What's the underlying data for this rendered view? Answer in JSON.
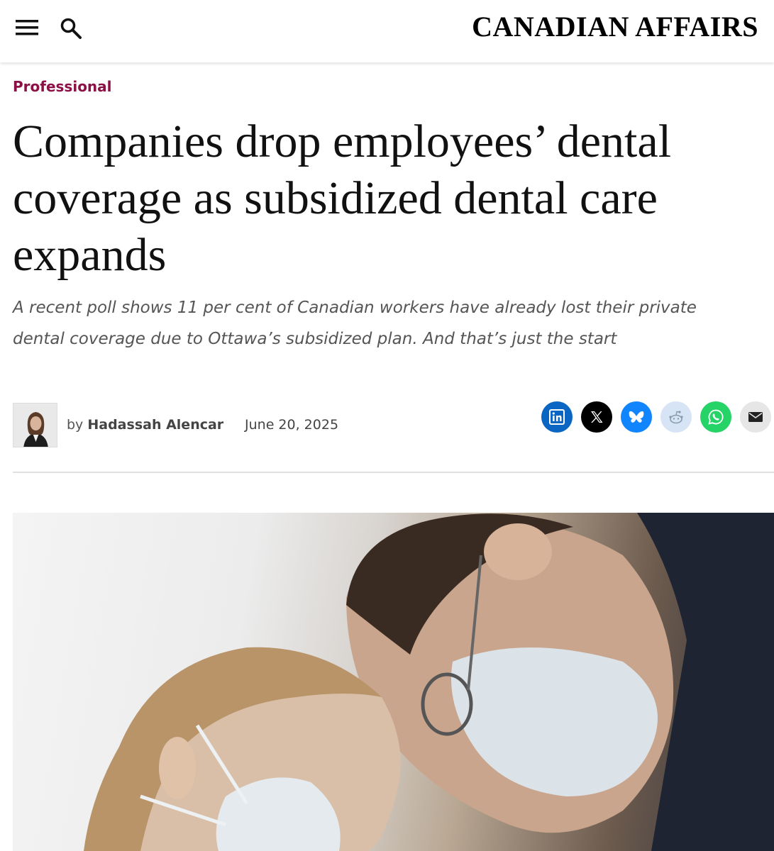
{
  "header": {
    "brand": "CANADIAN AFFAIRS",
    "menu_icon": "hamburger-menu-icon",
    "search_icon": "search-icon"
  },
  "article": {
    "category": "Professional",
    "headline": "Companies drop employees’ dental coverage as subsidized dental care expands",
    "dek": "A recent poll shows 11 per cent of Canadian workers have already lost their private dental coverage due to Ottawa’s subsidized plan. And that’s just the start",
    "byline_prefix": "by",
    "author": "Hadassah Alencar",
    "date": "June 20, 2025"
  },
  "share_buttons": [
    {
      "name": "LinkedIn",
      "icon": "linkedin-icon",
      "color": "#0a66c2"
    },
    {
      "name": "X",
      "icon": "x-icon",
      "color": "#000000"
    },
    {
      "name": "Bluesky",
      "icon": "bluesky-icon",
      "color": "#1185fe"
    },
    {
      "name": "Reddit",
      "icon": "reddit-icon",
      "color": "#d6e4f5"
    },
    {
      "name": "WhatsApp",
      "icon": "whatsapp-icon",
      "color": "#25d366"
    },
    {
      "name": "Email",
      "icon": "email-icon",
      "color": "#e6e6e6"
    }
  ],
  "colors": {
    "category": "#8b1045",
    "headline": "#111111",
    "dek": "#555555"
  }
}
